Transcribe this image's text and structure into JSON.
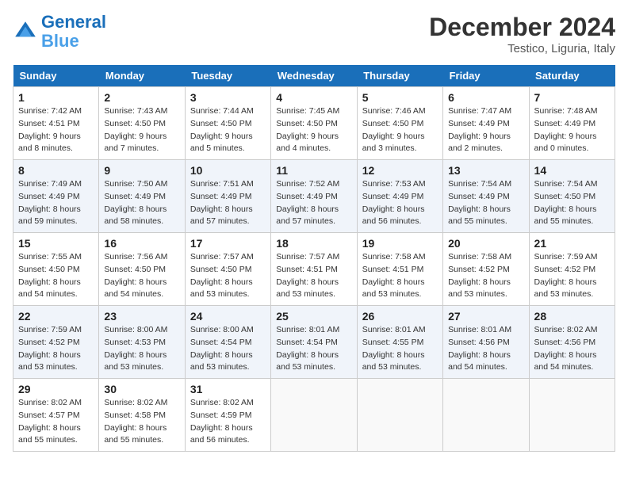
{
  "header": {
    "logo_line1": "General",
    "logo_line2": "Blue",
    "month_title": "December 2024",
    "location": "Testico, Liguria, Italy"
  },
  "weekdays": [
    "Sunday",
    "Monday",
    "Tuesday",
    "Wednesday",
    "Thursday",
    "Friday",
    "Saturday"
  ],
  "weeks": [
    [
      {
        "day": "1",
        "info": "Sunrise: 7:42 AM\nSunset: 4:51 PM\nDaylight: 9 hours and 8 minutes."
      },
      {
        "day": "2",
        "info": "Sunrise: 7:43 AM\nSunset: 4:50 PM\nDaylight: 9 hours and 7 minutes."
      },
      {
        "day": "3",
        "info": "Sunrise: 7:44 AM\nSunset: 4:50 PM\nDaylight: 9 hours and 5 minutes."
      },
      {
        "day": "4",
        "info": "Sunrise: 7:45 AM\nSunset: 4:50 PM\nDaylight: 9 hours and 4 minutes."
      },
      {
        "day": "5",
        "info": "Sunrise: 7:46 AM\nSunset: 4:50 PM\nDaylight: 9 hours and 3 minutes."
      },
      {
        "day": "6",
        "info": "Sunrise: 7:47 AM\nSunset: 4:49 PM\nDaylight: 9 hours and 2 minutes."
      },
      {
        "day": "7",
        "info": "Sunrise: 7:48 AM\nSunset: 4:49 PM\nDaylight: 9 hours and 0 minutes."
      }
    ],
    [
      {
        "day": "8",
        "info": "Sunrise: 7:49 AM\nSunset: 4:49 PM\nDaylight: 8 hours and 59 minutes."
      },
      {
        "day": "9",
        "info": "Sunrise: 7:50 AM\nSunset: 4:49 PM\nDaylight: 8 hours and 58 minutes."
      },
      {
        "day": "10",
        "info": "Sunrise: 7:51 AM\nSunset: 4:49 PM\nDaylight: 8 hours and 57 minutes."
      },
      {
        "day": "11",
        "info": "Sunrise: 7:52 AM\nSunset: 4:49 PM\nDaylight: 8 hours and 57 minutes."
      },
      {
        "day": "12",
        "info": "Sunrise: 7:53 AM\nSunset: 4:49 PM\nDaylight: 8 hours and 56 minutes."
      },
      {
        "day": "13",
        "info": "Sunrise: 7:54 AM\nSunset: 4:49 PM\nDaylight: 8 hours and 55 minutes."
      },
      {
        "day": "14",
        "info": "Sunrise: 7:54 AM\nSunset: 4:50 PM\nDaylight: 8 hours and 55 minutes."
      }
    ],
    [
      {
        "day": "15",
        "info": "Sunrise: 7:55 AM\nSunset: 4:50 PM\nDaylight: 8 hours and 54 minutes."
      },
      {
        "day": "16",
        "info": "Sunrise: 7:56 AM\nSunset: 4:50 PM\nDaylight: 8 hours and 54 minutes."
      },
      {
        "day": "17",
        "info": "Sunrise: 7:57 AM\nSunset: 4:50 PM\nDaylight: 8 hours and 53 minutes."
      },
      {
        "day": "18",
        "info": "Sunrise: 7:57 AM\nSunset: 4:51 PM\nDaylight: 8 hours and 53 minutes."
      },
      {
        "day": "19",
        "info": "Sunrise: 7:58 AM\nSunset: 4:51 PM\nDaylight: 8 hours and 53 minutes."
      },
      {
        "day": "20",
        "info": "Sunrise: 7:58 AM\nSunset: 4:52 PM\nDaylight: 8 hours and 53 minutes."
      },
      {
        "day": "21",
        "info": "Sunrise: 7:59 AM\nSunset: 4:52 PM\nDaylight: 8 hours and 53 minutes."
      }
    ],
    [
      {
        "day": "22",
        "info": "Sunrise: 7:59 AM\nSunset: 4:52 PM\nDaylight: 8 hours and 53 minutes."
      },
      {
        "day": "23",
        "info": "Sunrise: 8:00 AM\nSunset: 4:53 PM\nDaylight: 8 hours and 53 minutes."
      },
      {
        "day": "24",
        "info": "Sunrise: 8:00 AM\nSunset: 4:54 PM\nDaylight: 8 hours and 53 minutes."
      },
      {
        "day": "25",
        "info": "Sunrise: 8:01 AM\nSunset: 4:54 PM\nDaylight: 8 hours and 53 minutes."
      },
      {
        "day": "26",
        "info": "Sunrise: 8:01 AM\nSunset: 4:55 PM\nDaylight: 8 hours and 53 minutes."
      },
      {
        "day": "27",
        "info": "Sunrise: 8:01 AM\nSunset: 4:56 PM\nDaylight: 8 hours and 54 minutes."
      },
      {
        "day": "28",
        "info": "Sunrise: 8:02 AM\nSunset: 4:56 PM\nDaylight: 8 hours and 54 minutes."
      }
    ],
    [
      {
        "day": "29",
        "info": "Sunrise: 8:02 AM\nSunset: 4:57 PM\nDaylight: 8 hours and 55 minutes."
      },
      {
        "day": "30",
        "info": "Sunrise: 8:02 AM\nSunset: 4:58 PM\nDaylight: 8 hours and 55 minutes."
      },
      {
        "day": "31",
        "info": "Sunrise: 8:02 AM\nSunset: 4:59 PM\nDaylight: 8 hours and 56 minutes."
      },
      null,
      null,
      null,
      null
    ]
  ]
}
